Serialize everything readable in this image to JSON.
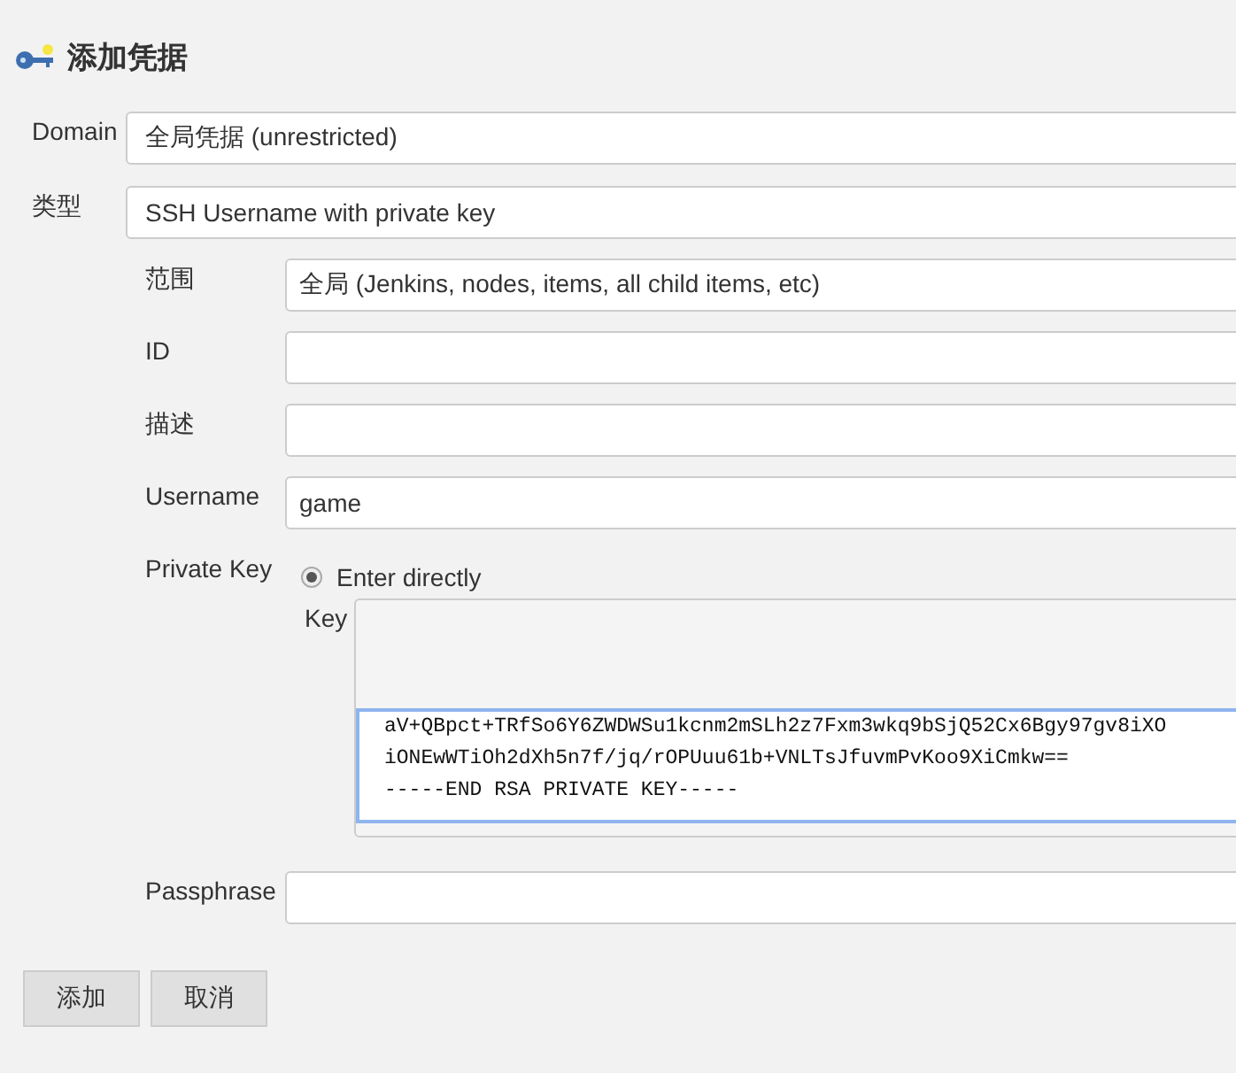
{
  "title": "添加凭据",
  "fields": [
    {
      "label": "Domain",
      "value": "全局凭据 (unrestricted)"
    },
    {
      "label": "类型",
      "value": "SSH Username with private key"
    }
  ],
  "subfields": [
    {
      "label": "范围",
      "value": "全局 (Jenkins, nodes, items, all child items, etc)"
    },
    {
      "label": "ID"
    },
    {
      "label": "描述"
    },
    {
      "label": "Username",
      "value": "game"
    }
  ],
  "private_key": {
    "label": "Private Key",
    "option": {
      "label": "Enter directly",
      "selected": true
    },
    "key_label": "Key",
    "key_lines": [
      "aV+QBpct+TRfSo6Y6ZWDWSu1kcnm2mSLh2z7Fxm3wkq9bSjQ52Cx6Bgy97gv8iXO",
      "iONEwWTiOh2dXh5n7f/jq/rOPUuu61b+VNLTsJfuvmPvKoo9XiCmkw==",
      "-----END RSA PRIVATE KEY-----"
    ]
  },
  "passphrase": {
    "label": "Passphrase"
  },
  "buttons": [
    "添加",
    "取消"
  ]
}
